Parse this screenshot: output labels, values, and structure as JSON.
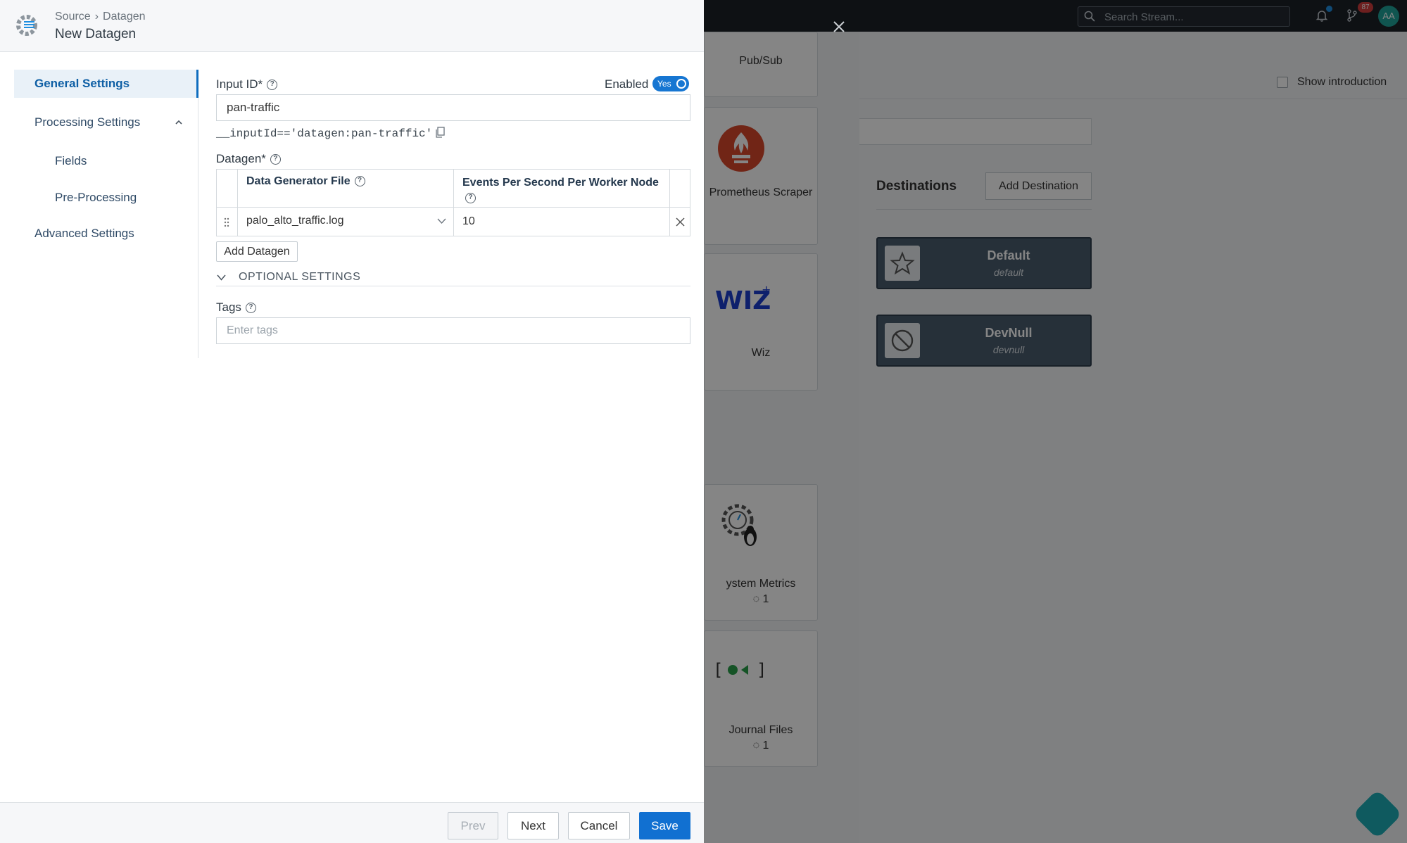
{
  "background": {
    "search_placeholder": "Search Stream...",
    "notif_count": "87",
    "avatar_initials": "AA",
    "show_intro_label": "Show introduction",
    "destinations_title": "Destinations",
    "add_destination_label": "Add Destination",
    "destinations": [
      {
        "name": "Default",
        "id": "default",
        "icon": "star-icon"
      },
      {
        "name": "DevNull",
        "id": "devnull",
        "icon": "blocked-icon"
      }
    ],
    "sources": [
      {
        "label": "Pub/Sub"
      },
      {
        "label": "Prometheus Scraper"
      },
      {
        "label": "Wiz"
      },
      {
        "label": "ystem Metrics",
        "count": "1"
      },
      {
        "label": "Journal Files",
        "count": "1"
      }
    ]
  },
  "modal": {
    "breadcrumb": {
      "parent": "Source",
      "separator": "›",
      "current": "Datagen"
    },
    "title": "New Datagen",
    "nav": [
      {
        "label": "General Settings",
        "active": true
      },
      {
        "label": "Processing Settings"
      },
      {
        "label": "Fields"
      },
      {
        "label": "Pre-Processing"
      },
      {
        "label": "Advanced Settings"
      }
    ],
    "input_id_label": "Input ID*",
    "enabled_label": "Enabled",
    "toggle_text": "Yes",
    "input_id_value": "pan-traffic",
    "filter_expression": "__inputId=='datagen:pan-traffic'",
    "datagen_label": "Datagen*",
    "table": {
      "col_file": "Data Generator File",
      "col_eps": "Events Per Second Per Worker Node",
      "rows": [
        {
          "file": "palo_alto_traffic.log",
          "eps": "10"
        }
      ]
    },
    "add_datagen_label": "Add Datagen",
    "optional_settings_label": "OPTIONAL SETTINGS",
    "tags_label": "Tags",
    "tags_placeholder": "Enter tags",
    "footer": {
      "prev": "Prev",
      "next": "Next",
      "cancel": "Cancel",
      "save": "Save"
    }
  },
  "colors": {
    "accent": "#1170d1",
    "toggle_on": "#1676d2",
    "nav_active": "#0e5fa5"
  }
}
